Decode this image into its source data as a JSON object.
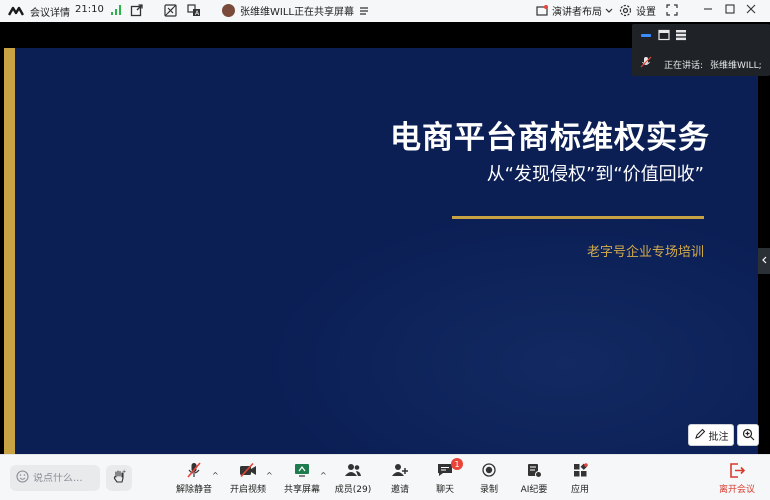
{
  "topbar": {
    "meeting_info_label": "会议详情",
    "time": "21:10",
    "sharer_text": "张维维WILL正在共享屏幕",
    "layout_label": "演讲者布局",
    "settings_label": "设置"
  },
  "slide": {
    "title": "电商平台商标维权实务",
    "subtitle": "从“发现侵权”到“价值回收”",
    "tagline": "老字号企业专场培训",
    "colors": {
      "background": "#0b1f55",
      "gold": "#c9a243",
      "text": "#ffffff"
    }
  },
  "speaker_panel": {
    "speaking_label": "正在讲话:",
    "speaker_name": "张维维WILL;"
  },
  "stage_tools": {
    "annotate_label": "批注"
  },
  "toolbar": {
    "chat_placeholder": "说点什么...",
    "mute_label": "解除静音",
    "video_label": "开启视频",
    "share_label": "共享屏幕",
    "members_label": "成员(29)",
    "invite_label": "邀请",
    "chat_label": "聊天",
    "chat_badge": "1",
    "record_label": "录制",
    "ai_label": "AI纪要",
    "apps_label": "应用",
    "leave_label": "离开会议",
    "leave_color": "#d83b2f"
  }
}
